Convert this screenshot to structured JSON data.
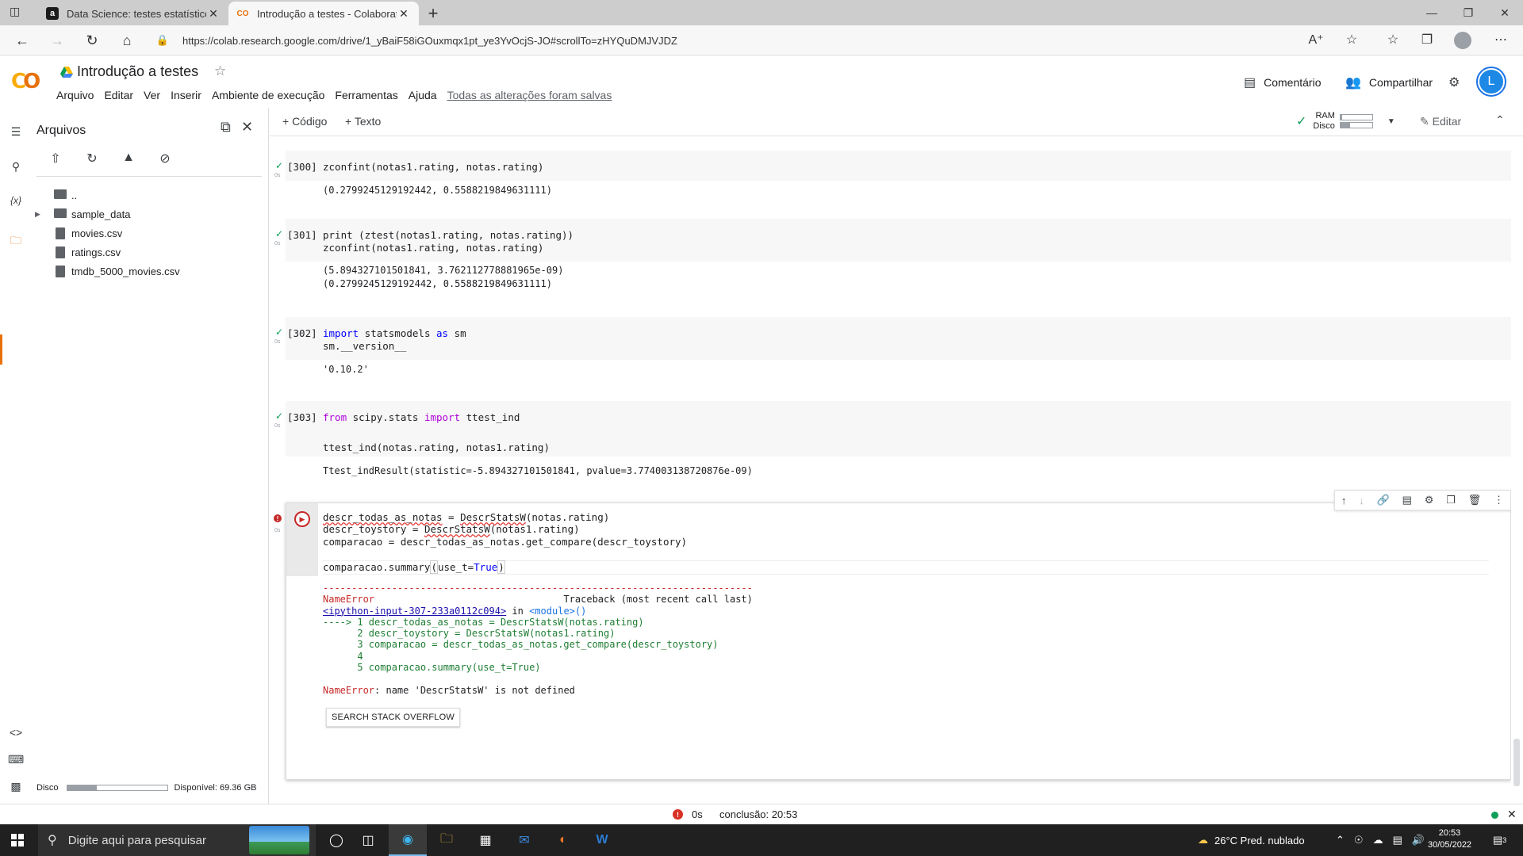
{
  "browser": {
    "tabs": [
      {
        "label": "Data Science: testes estatísticos",
        "favicon": "a",
        "active": false
      },
      {
        "label": "Introdução a testes - Colaborato",
        "favicon": "CO",
        "active": true
      }
    ],
    "url": "https://colab.research.google.com/drive/1_yBaiF58iGOuxmqx1pt_ye3YvOcjS-JO#scrollTo=zHYQuDMJVJDZ"
  },
  "colab": {
    "title": "Introdução a testes",
    "menu": [
      "Arquivo",
      "Editar",
      "Ver",
      "Inserir",
      "Ambiente de execução",
      "Ferramentas",
      "Ajuda"
    ],
    "saved_status": "Todas as alterações foram salvas",
    "comment_label": "Comentário",
    "share_label": "Compartilhar",
    "user_initial": "L",
    "accent": "#e8710a"
  },
  "files": {
    "title": "Arquivos",
    "items": [
      {
        "name": "..",
        "type": "up"
      },
      {
        "name": "sample_data",
        "type": "folder"
      },
      {
        "name": "movies.csv",
        "type": "file"
      },
      {
        "name": "ratings.csv",
        "type": "file"
      },
      {
        "name": "tmdb_5000_movies.csv",
        "type": "file"
      }
    ],
    "disk_label": "Disco",
    "disk_available": "Disponível: 69.36 GB",
    "disk_used_fraction": 0.3
  },
  "toolbar": {
    "add_code": "+ Código",
    "add_text": "+ Texto",
    "ram_label": "RAM",
    "disk_label": "Disco",
    "edit_label": "Editar",
    "ram_fraction": 0.05,
    "disk_fraction": 0.3
  },
  "cells": [
    {
      "exec": "[300]",
      "secs": "0s",
      "code": [
        "zconfint(notas1.rating, notas.rating)"
      ],
      "output": [
        "(0.2799245129192442, 0.5588219849631111)"
      ]
    },
    {
      "exec": "[301]",
      "secs": "0s",
      "code": [
        "print (ztest(notas1.rating, notas.rating))",
        "zconfint(notas1.rating, notas.rating)"
      ],
      "output": [
        "(5.894327101501841, 3.762112778881965e-09)",
        "(0.2799245129192442, 0.5588219849631111)"
      ]
    },
    {
      "exec": "[302]",
      "secs": "0s",
      "code": [
        "import statsmodels as sm",
        "sm.__version__"
      ],
      "output": [
        "'0.10.2'"
      ]
    },
    {
      "exec": "[303]",
      "secs": "0s",
      "code": [
        "from scipy.stats import ttest_ind",
        "",
        "ttest_ind(notas.rating, notas1.rating)"
      ],
      "output": [
        "Ttest_indResult(statistic=-5.894327101501841, pvalue=3.774003138720876e-09)"
      ]
    }
  ],
  "active_cell": {
    "secs": "0s",
    "code": [
      "descr_todas_as_notas = DescrStatsW(notas.rating)",
      "descr_toystory = DescrStatsW(notas1.rating)",
      "comparacao = descr_todas_as_notas.get_compare(descr_toystory)",
      "",
      "comparacao.summary(use_t=True)"
    ],
    "error": {
      "dashes": "---------------------------------------------------------------------------",
      "name": "NameError",
      "traceback_label": "Traceback (most recent call last)",
      "input_link": "<ipython-input-307-233a0112c094>",
      "in_text": " in ",
      "module": "<module>()",
      "lines": [
        "----> 1 descr_todas_as_notas = DescrStatsW(notas.rating)",
        "      2 descr_toystory = DescrStatsW(notas1.rating)",
        "      3 comparacao = descr_todas_as_notas.get_compare(descr_toystory)",
        "      4",
        "      5 comparacao.summary(use_t=True)"
      ],
      "message_name": "NameError",
      "message": ": name 'DescrStatsW' is not defined"
    },
    "so_button": "SEARCH STACK OVERFLOW"
  },
  "statusbar": {
    "time": "0s",
    "completion": "conclusão: 20:53"
  },
  "taskbar": {
    "search_placeholder": "Digite aqui para pesquisar",
    "weather": "26°C  Pred. nublado",
    "time": "20:53",
    "date": "30/05/2022",
    "notifications": "3"
  }
}
